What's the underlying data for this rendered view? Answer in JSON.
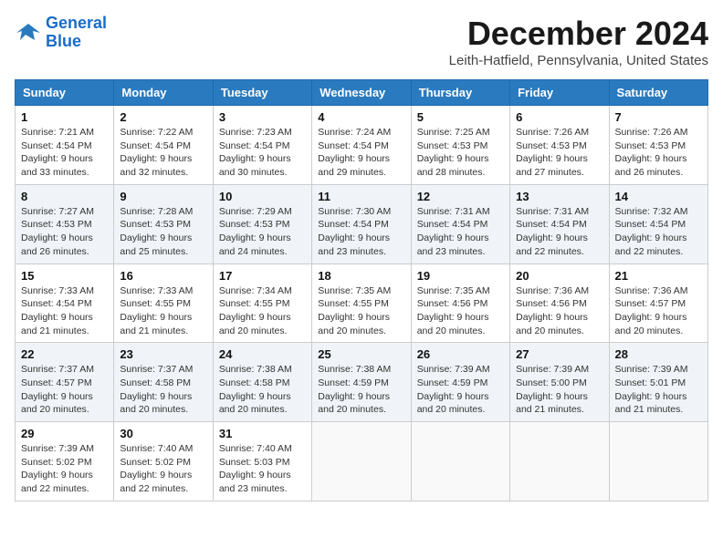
{
  "header": {
    "logo_line1": "General",
    "logo_line2": "Blue",
    "month_title": "December 2024",
    "location": "Leith-Hatfield, Pennsylvania, United States"
  },
  "calendar": {
    "days_of_week": [
      "Sunday",
      "Monday",
      "Tuesday",
      "Wednesday",
      "Thursday",
      "Friday",
      "Saturday"
    ],
    "weeks": [
      [
        {
          "day": "1",
          "sunrise": "Sunrise: 7:21 AM",
          "sunset": "Sunset: 4:54 PM",
          "daylight": "Daylight: 9 hours and 33 minutes."
        },
        {
          "day": "2",
          "sunrise": "Sunrise: 7:22 AM",
          "sunset": "Sunset: 4:54 PM",
          "daylight": "Daylight: 9 hours and 32 minutes."
        },
        {
          "day": "3",
          "sunrise": "Sunrise: 7:23 AM",
          "sunset": "Sunset: 4:54 PM",
          "daylight": "Daylight: 9 hours and 30 minutes."
        },
        {
          "day": "4",
          "sunrise": "Sunrise: 7:24 AM",
          "sunset": "Sunset: 4:54 PM",
          "daylight": "Daylight: 9 hours and 29 minutes."
        },
        {
          "day": "5",
          "sunrise": "Sunrise: 7:25 AM",
          "sunset": "Sunset: 4:53 PM",
          "daylight": "Daylight: 9 hours and 28 minutes."
        },
        {
          "day": "6",
          "sunrise": "Sunrise: 7:26 AM",
          "sunset": "Sunset: 4:53 PM",
          "daylight": "Daylight: 9 hours and 27 minutes."
        },
        {
          "day": "7",
          "sunrise": "Sunrise: 7:26 AM",
          "sunset": "Sunset: 4:53 PM",
          "daylight": "Daylight: 9 hours and 26 minutes."
        }
      ],
      [
        {
          "day": "8",
          "sunrise": "Sunrise: 7:27 AM",
          "sunset": "Sunset: 4:53 PM",
          "daylight": "Daylight: 9 hours and 26 minutes."
        },
        {
          "day": "9",
          "sunrise": "Sunrise: 7:28 AM",
          "sunset": "Sunset: 4:53 PM",
          "daylight": "Daylight: 9 hours and 25 minutes."
        },
        {
          "day": "10",
          "sunrise": "Sunrise: 7:29 AM",
          "sunset": "Sunset: 4:53 PM",
          "daylight": "Daylight: 9 hours and 24 minutes."
        },
        {
          "day": "11",
          "sunrise": "Sunrise: 7:30 AM",
          "sunset": "Sunset: 4:54 PM",
          "daylight": "Daylight: 9 hours and 23 minutes."
        },
        {
          "day": "12",
          "sunrise": "Sunrise: 7:31 AM",
          "sunset": "Sunset: 4:54 PM",
          "daylight": "Daylight: 9 hours and 23 minutes."
        },
        {
          "day": "13",
          "sunrise": "Sunrise: 7:31 AM",
          "sunset": "Sunset: 4:54 PM",
          "daylight": "Daylight: 9 hours and 22 minutes."
        },
        {
          "day": "14",
          "sunrise": "Sunrise: 7:32 AM",
          "sunset": "Sunset: 4:54 PM",
          "daylight": "Daylight: 9 hours and 22 minutes."
        }
      ],
      [
        {
          "day": "15",
          "sunrise": "Sunrise: 7:33 AM",
          "sunset": "Sunset: 4:54 PM",
          "daylight": "Daylight: 9 hours and 21 minutes."
        },
        {
          "day": "16",
          "sunrise": "Sunrise: 7:33 AM",
          "sunset": "Sunset: 4:55 PM",
          "daylight": "Daylight: 9 hours and 21 minutes."
        },
        {
          "day": "17",
          "sunrise": "Sunrise: 7:34 AM",
          "sunset": "Sunset: 4:55 PM",
          "daylight": "Daylight: 9 hours and 20 minutes."
        },
        {
          "day": "18",
          "sunrise": "Sunrise: 7:35 AM",
          "sunset": "Sunset: 4:55 PM",
          "daylight": "Daylight: 9 hours and 20 minutes."
        },
        {
          "day": "19",
          "sunrise": "Sunrise: 7:35 AM",
          "sunset": "Sunset: 4:56 PM",
          "daylight": "Daylight: 9 hours and 20 minutes."
        },
        {
          "day": "20",
          "sunrise": "Sunrise: 7:36 AM",
          "sunset": "Sunset: 4:56 PM",
          "daylight": "Daylight: 9 hours and 20 minutes."
        },
        {
          "day": "21",
          "sunrise": "Sunrise: 7:36 AM",
          "sunset": "Sunset: 4:57 PM",
          "daylight": "Daylight: 9 hours and 20 minutes."
        }
      ],
      [
        {
          "day": "22",
          "sunrise": "Sunrise: 7:37 AM",
          "sunset": "Sunset: 4:57 PM",
          "daylight": "Daylight: 9 hours and 20 minutes."
        },
        {
          "day": "23",
          "sunrise": "Sunrise: 7:37 AM",
          "sunset": "Sunset: 4:58 PM",
          "daylight": "Daylight: 9 hours and 20 minutes."
        },
        {
          "day": "24",
          "sunrise": "Sunrise: 7:38 AM",
          "sunset": "Sunset: 4:58 PM",
          "daylight": "Daylight: 9 hours and 20 minutes."
        },
        {
          "day": "25",
          "sunrise": "Sunrise: 7:38 AM",
          "sunset": "Sunset: 4:59 PM",
          "daylight": "Daylight: 9 hours and 20 minutes."
        },
        {
          "day": "26",
          "sunrise": "Sunrise: 7:39 AM",
          "sunset": "Sunset: 4:59 PM",
          "daylight": "Daylight: 9 hours and 20 minutes."
        },
        {
          "day": "27",
          "sunrise": "Sunrise: 7:39 AM",
          "sunset": "Sunset: 5:00 PM",
          "daylight": "Daylight: 9 hours and 21 minutes."
        },
        {
          "day": "28",
          "sunrise": "Sunrise: 7:39 AM",
          "sunset": "Sunset: 5:01 PM",
          "daylight": "Daylight: 9 hours and 21 minutes."
        }
      ],
      [
        {
          "day": "29",
          "sunrise": "Sunrise: 7:39 AM",
          "sunset": "Sunset: 5:02 PM",
          "daylight": "Daylight: 9 hours and 22 minutes."
        },
        {
          "day": "30",
          "sunrise": "Sunrise: 7:40 AM",
          "sunset": "Sunset: 5:02 PM",
          "daylight": "Daylight: 9 hours and 22 minutes."
        },
        {
          "day": "31",
          "sunrise": "Sunrise: 7:40 AM",
          "sunset": "Sunset: 5:03 PM",
          "daylight": "Daylight: 9 hours and 23 minutes."
        },
        null,
        null,
        null,
        null
      ]
    ]
  }
}
